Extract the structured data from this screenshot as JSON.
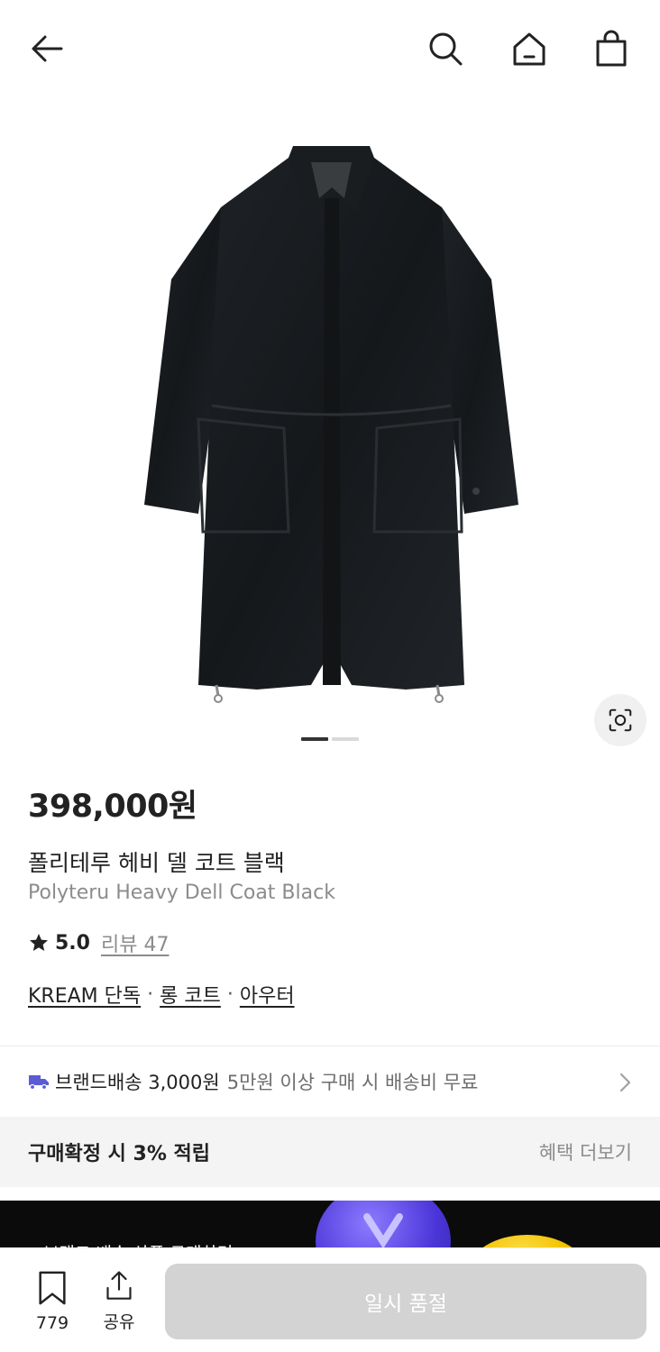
{
  "header": {
    "back_icon": "arrow-left-icon",
    "search_icon": "search-icon",
    "home_icon": "home-icon",
    "cart_icon": "shopping-bag-icon"
  },
  "gallery": {
    "image_alt": "product image: black long coat",
    "page_indicator": {
      "current": 1,
      "total": 2
    },
    "lens_icon": "image-search-icon"
  },
  "product": {
    "price": "398,000원",
    "name_ko": "폴리테루 헤비 델 코트 블랙",
    "name_en": "Polyteru Heavy Dell Coat Black",
    "rating": "5.0",
    "review_label": "리뷰 47",
    "tags": [
      "KREAM 단독",
      "롱 코트",
      "아우터"
    ],
    "tag_separator": "·"
  },
  "shipping": {
    "label": "브랜드배송 3,000원",
    "sub": "5만원 이상 구매 시 배송비 무료",
    "icon": "truck-icon"
  },
  "benefit": {
    "title": "구매확정 시 3% 적립",
    "more": "혜택 더보기"
  },
  "banner": {
    "text": "브랜드 배송 상품 구매하면"
  },
  "bottom_bar": {
    "save_count": "779",
    "share_label": "공유",
    "main_button": "일시 품절"
  },
  "colors": {
    "text_primary": "#222222",
    "text_secondary": "#8c8c8c",
    "button_disabled": "#d3d3d3",
    "benefit_bg": "#f4f4f4",
    "shipping_icon": "#5b5bd6"
  }
}
